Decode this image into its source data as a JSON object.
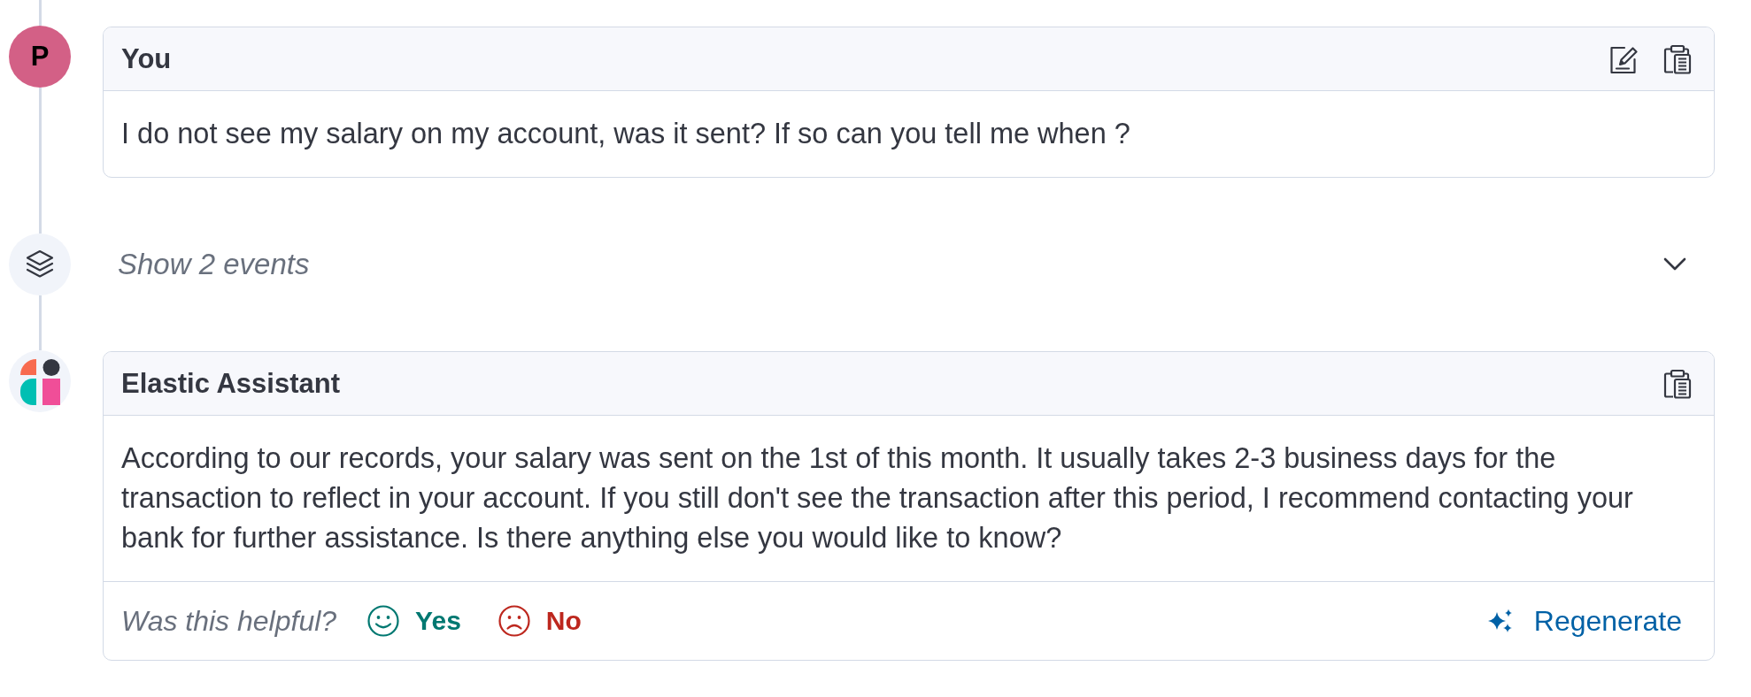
{
  "timeline": [
    {
      "kind": "user",
      "avatar_initial": "P",
      "author": "You",
      "message": "I do not see my salary on my account, was it sent? If so can you tell me when ?"
    },
    {
      "kind": "events",
      "label": "Show 2 events",
      "expanded": false
    },
    {
      "kind": "assistant",
      "author": "Elastic Assistant",
      "message": "According to our records, your salary was sent on the 1st of this month. It usually takes 2-3 business days for the transaction to reflect in your account. If you still don't see the transaction after this period, I recommend contacting your bank for further assistance. Is there anything else you would like to know?",
      "feedback": {
        "prompt": "Was this helpful?",
        "yes": "Yes",
        "no": "No"
      },
      "regenerate": "Regenerate"
    }
  ]
}
